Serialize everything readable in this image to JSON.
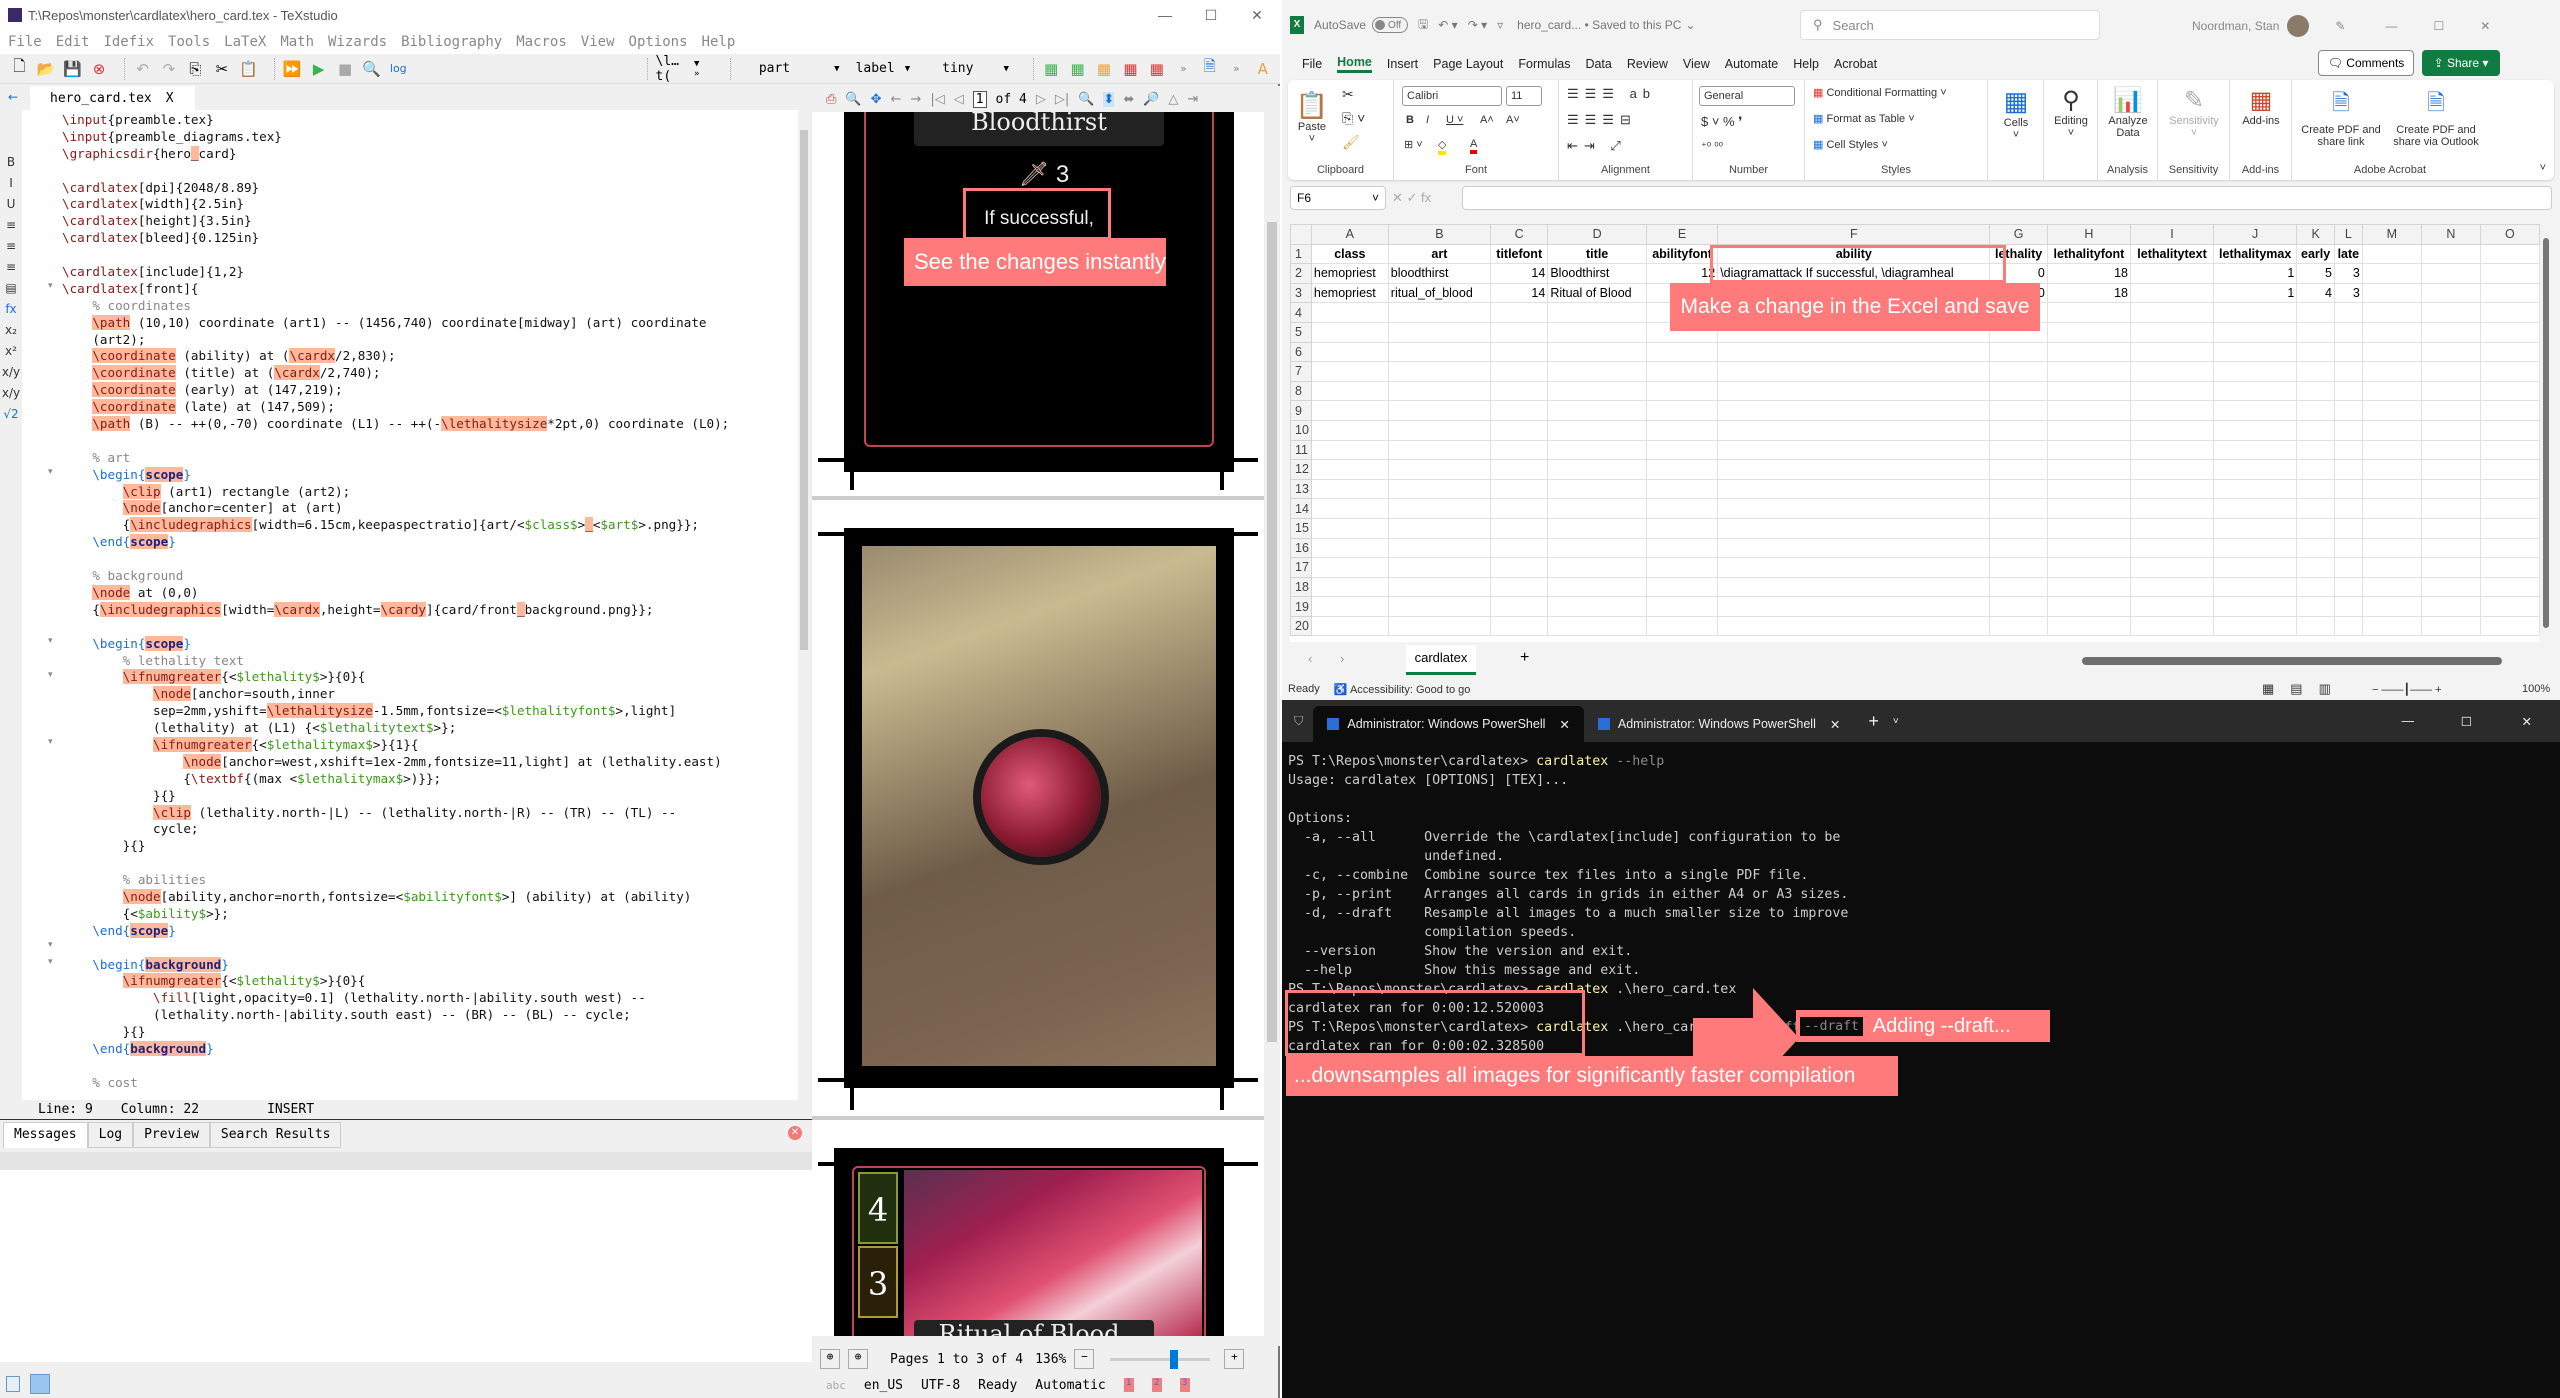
{
  "texstudio": {
    "window_title": "T:\\Repos\\monster\\cardlatex\\hero_card.tex - TeXstudio",
    "menu": [
      "File",
      "Edit",
      "Idefix",
      "Tools",
      "LaTeX",
      "Math",
      "Wizards",
      "Bibliography",
      "Macros",
      "View",
      "Options",
      "Help"
    ],
    "toolbar": {
      "icons": [
        "new-file-icon",
        "open-folder-icon",
        "save-icon",
        "close-file-icon",
        "undo-icon",
        "redo-icon",
        "copy-icon",
        "cut-icon",
        "paste-icon",
        "build-view-icon",
        "compile-icon",
        "stop-icon",
        "view-pdf-icon",
        "log-icon"
      ],
      "log_label": "log",
      "combo_ref": "\\l…t(",
      "combo_section": "part",
      "combo_label": "label",
      "combo_size": "tiny"
    },
    "tab": {
      "label": "hero_card.tex",
      "close": "X"
    },
    "sidebar_icons": [
      "B",
      "I",
      "U",
      "≡",
      "≡",
      "≡",
      "▤",
      "fx",
      "x₂",
      "x²",
      "x/y",
      "x/y",
      "√2"
    ],
    "code_lines": [
      [
        [
          "kw",
          "\\input"
        ],
        [
          "",
          "{preamble.tex}"
        ]
      ],
      [
        [
          "kw",
          "\\input"
        ],
        [
          "",
          "{preamble_diagrams.tex}"
        ]
      ],
      [
        [
          "kw",
          "\\graphicsdir"
        ],
        [
          "",
          "{hero"
        ],
        [
          "hl",
          "_"
        ],
        [
          "",
          "card}"
        ]
      ],
      [
        [
          "",
          ""
        ]
      ],
      [
        [
          "kw",
          "\\cardlatex"
        ],
        [
          "",
          "[dpi]{2048/8.89}"
        ]
      ],
      [
        [
          "kw",
          "\\cardlatex"
        ],
        [
          "",
          "[width]{2.5in}"
        ]
      ],
      [
        [
          "kw",
          "\\cardlatex"
        ],
        [
          "",
          "[height]{3.5in}"
        ]
      ],
      [
        [
          "kw",
          "\\cardlatex"
        ],
        [
          "",
          "[bleed]{0.125in}"
        ]
      ],
      [
        [
          "",
          ""
        ]
      ],
      [
        [
          "kw",
          "\\cardlatex"
        ],
        [
          "",
          "[include]{1,2}"
        ]
      ],
      [
        [
          "kw",
          "\\cardlatex"
        ],
        [
          "",
          "[front]{"
        ]
      ],
      [
        [
          "",
          "    "
        ],
        [
          "cm",
          "% coordinates"
        ]
      ],
      [
        [
          "",
          "    "
        ],
        [
          "hlk",
          "\\path"
        ],
        [
          "",
          " (10,10) coordinate (art1) -- (1456,740) coordinate[midway] (art) coordinate"
        ]
      ],
      [
        [
          "",
          "    (art2);"
        ]
      ],
      [
        [
          "",
          "    "
        ],
        [
          "hlk",
          "\\coordinate"
        ],
        [
          "",
          " (ability) at ("
        ],
        [
          "hlk",
          "\\cardx"
        ],
        [
          "",
          "/2,830);"
        ]
      ],
      [
        [
          "",
          "    "
        ],
        [
          "hlk",
          "\\coordinate"
        ],
        [
          "",
          " (title) at ("
        ],
        [
          "hlk",
          "\\cardx"
        ],
        [
          "",
          "/2,740);"
        ]
      ],
      [
        [
          "",
          "    "
        ],
        [
          "hlk",
          "\\coordinate"
        ],
        [
          "",
          " (early) at (147,219);"
        ]
      ],
      [
        [
          "",
          "    "
        ],
        [
          "hlk",
          "\\coordinate"
        ],
        [
          "",
          " (late) at (147,509);"
        ]
      ],
      [
        [
          "",
          "    "
        ],
        [
          "hlk",
          "\\path"
        ],
        [
          "",
          " (B) -- ++(0,-70) coordinate (L1) -- ++(-"
        ],
        [
          "hlk",
          "\\lethalitysize"
        ],
        [
          "",
          "*2pt,0) coordinate (L0);"
        ]
      ],
      [
        [
          "",
          ""
        ]
      ],
      [
        [
          "",
          "    "
        ],
        [
          "cm",
          "% art"
        ]
      ],
      [
        [
          "",
          "    "
        ],
        [
          "env",
          "\\begin{"
        ],
        [
          "envh",
          "scope"
        ],
        [
          "env",
          "}"
        ]
      ],
      [
        [
          "",
          "        "
        ],
        [
          "hlk",
          "\\clip"
        ],
        [
          "",
          " (art1) rectangle (art2);"
        ]
      ],
      [
        [
          "",
          "        "
        ],
        [
          "hlk",
          "\\node"
        ],
        [
          "",
          "[anchor=center] at (art)"
        ]
      ],
      [
        [
          "",
          "        {"
        ],
        [
          "hlk",
          "\\includegraphics"
        ],
        [
          "",
          "[width=6.15cm,keepaspectratio]{art/<"
        ],
        [
          "var",
          "$class$"
        ],
        [
          "",
          ">"
        ],
        [
          "hl",
          "_"
        ],
        [
          "",
          "<"
        ],
        [
          "var",
          "$art$"
        ],
        [
          "",
          ">.png}};"
        ]
      ],
      [
        [
          "",
          "    "
        ],
        [
          "env",
          "\\end{"
        ],
        [
          "envh",
          "scope"
        ],
        [
          "env",
          "}"
        ]
      ],
      [
        [
          "",
          ""
        ]
      ],
      [
        [
          "",
          "    "
        ],
        [
          "cm",
          "% background"
        ]
      ],
      [
        [
          "",
          "    "
        ],
        [
          "hlk",
          "\\node"
        ],
        [
          "",
          " at (0,0)"
        ]
      ],
      [
        [
          "",
          "    {"
        ],
        [
          "hlk",
          "\\includegraphics"
        ],
        [
          "",
          "[width="
        ],
        [
          "hlk",
          "\\cardx"
        ],
        [
          "",
          ",height="
        ],
        [
          "hlk",
          "\\cardy"
        ],
        [
          "",
          "]{card/front"
        ],
        [
          "hl",
          "_"
        ],
        [
          "",
          "background.png}};"
        ]
      ],
      [
        [
          "",
          ""
        ]
      ],
      [
        [
          "",
          "    "
        ],
        [
          "env",
          "\\begin{"
        ],
        [
          "envh",
          "scope"
        ],
        [
          "env",
          "}"
        ]
      ],
      [
        [
          "",
          "        "
        ],
        [
          "cm",
          "% lethality text"
        ]
      ],
      [
        [
          "",
          "        "
        ],
        [
          "hlk",
          "\\ifnumgreater"
        ],
        [
          "",
          "{<"
        ],
        [
          "var",
          "$lethality$"
        ],
        [
          "",
          ">}{0}{"
        ]
      ],
      [
        [
          "",
          "            "
        ],
        [
          "hlk",
          "\\node"
        ],
        [
          "",
          "[anchor=south,inner"
        ]
      ],
      [
        [
          "",
          "            sep=2mm,yshift="
        ],
        [
          "hlk",
          "\\lethalitysize"
        ],
        [
          "",
          "-1.5mm,fontsize=<"
        ],
        [
          "var",
          "$lethalityfont$"
        ],
        [
          "",
          ">,light]"
        ]
      ],
      [
        [
          "",
          "            (lethality) at (L1) {<"
        ],
        [
          "var",
          "$lethalitytext$"
        ],
        [
          "",
          ">};"
        ]
      ],
      [
        [
          "",
          "            "
        ],
        [
          "hlk",
          "\\ifnumgreater"
        ],
        [
          "",
          "{<"
        ],
        [
          "var",
          "$lethalitymax$"
        ],
        [
          "",
          ">}{1}{"
        ]
      ],
      [
        [
          "",
          "                "
        ],
        [
          "hlk",
          "\\node"
        ],
        [
          "",
          "[anchor=west,xshift=1ex-2mm,fontsize=11,light] at (lethality.east)"
        ]
      ],
      [
        [
          "",
          "                {"
        ],
        [
          "kw",
          "\\textbf"
        ],
        [
          "",
          "{(max <"
        ],
        [
          "var",
          "$lethalitymax$"
        ],
        [
          "",
          ">)}};"
        ]
      ],
      [
        [
          "",
          "            }{}"
        ]
      ],
      [
        [
          "",
          "            "
        ],
        [
          "hlk",
          "\\clip"
        ],
        [
          "",
          " (lethality.north-|L) -- (lethality.north-|R) -- (TR) -- (TL) --"
        ]
      ],
      [
        [
          "",
          "            cycle;"
        ]
      ],
      [
        [
          "",
          "        }{}"
        ]
      ],
      [
        [
          "",
          ""
        ]
      ],
      [
        [
          "",
          "        "
        ],
        [
          "cm",
          "% abilities"
        ]
      ],
      [
        [
          "",
          "        "
        ],
        [
          "hlk",
          "\\node"
        ],
        [
          "",
          "[ability,anchor=north,fontsize=<"
        ],
        [
          "var",
          "$abilityfont$"
        ],
        [
          "",
          ">] (ability) at (ability)"
        ]
      ],
      [
        [
          "",
          "        {<"
        ],
        [
          "var",
          "$ability$"
        ],
        [
          "",
          ">};"
        ]
      ],
      [
        [
          "",
          "    "
        ],
        [
          "env",
          "\\end{"
        ],
        [
          "envh",
          "scope"
        ],
        [
          "env",
          "}"
        ]
      ],
      [
        [
          "",
          ""
        ]
      ],
      [
        [
          "",
          "    "
        ],
        [
          "env",
          "\\begin{"
        ],
        [
          "envh",
          "background"
        ],
        [
          "env",
          "}"
        ]
      ],
      [
        [
          "",
          "        "
        ],
        [
          "hlk",
          "\\ifnumgreater"
        ],
        [
          "",
          "{<"
        ],
        [
          "var",
          "$lethality$"
        ],
        [
          "",
          ">}{0}{"
        ]
      ],
      [
        [
          "",
          "            "
        ],
        [
          "kw",
          "\\fill"
        ],
        [
          "",
          "[light,opacity=0.1] (lethality.north-|ability.south west) --"
        ]
      ],
      [
        [
          "",
          "            (lethality.north-|ability.south east) -- (BR) -- (BL) -- cycle;"
        ]
      ],
      [
        [
          "",
          "        }{}"
        ]
      ],
      [
        [
          "",
          "    "
        ],
        [
          "env",
          "\\end{"
        ],
        [
          "envh",
          "background"
        ],
        [
          "env",
          "}"
        ]
      ],
      [
        [
          "",
          ""
        ]
      ],
      [
        [
          "",
          "    "
        ],
        [
          "cm",
          "% cost"
        ]
      ]
    ],
    "status": {
      "line": "Line: 9",
      "column": "Column: 22",
      "mode": "INSERT"
    },
    "message_tabs": [
      "Messages",
      "Log",
      "Preview",
      "Search Results"
    ],
    "pdf": {
      "page_current": "1",
      "page_of": "of 4",
      "pages_range": "Pages 1 to 3 of 4",
      "zoom": "136%",
      "zoom_level_percent": 136,
      "card1": {
        "title": "Bloodthirst",
        "lethality": "3",
        "ability_text": "If successful,"
      },
      "card3": {
        "title": "Ritual of Blood",
        "early": "4",
        "late": "3"
      }
    },
    "app_status": {
      "language": "en_US",
      "encoding": "UTF-8",
      "state": "Ready",
      "mode": "Automatic",
      "bookmarks": [
        "1",
        "2",
        "3"
      ]
    }
  },
  "excel": {
    "autosave_label": "AutoSave",
    "autosave_state": "Off",
    "file_title": "hero_card... • Saved to this PC",
    "search_placeholder": "Search",
    "user": "Noordman, Stan",
    "tabs": [
      "File",
      "Home",
      "Insert",
      "Page Layout",
      "Formulas",
      "Data",
      "Review",
      "View",
      "Automate",
      "Help",
      "Acrobat"
    ],
    "active_tab": "Home",
    "comments_label": "Comments",
    "share_label": "Share",
    "ribbon": {
      "paste": "Paste",
      "font_name": "Calibri",
      "font_size": "11",
      "number_format": "General",
      "conditional_formatting": "Conditional Formatting",
      "format_as_table": "Format as Table",
      "cell_styles": "Cell Styles",
      "cells": "Cells",
      "editing": "Editing",
      "analyze_data": "Analyze Data",
      "sensitivity": "Sensitivity",
      "add_ins": "Add-ins",
      "create_pdf_link": "Create PDF and share link",
      "create_pdf_outlook": "Create PDF and share via Outlook",
      "groups": [
        "Clipboard",
        "Font",
        "Alignment",
        "Number",
        "Styles",
        "Analysis",
        "Sensitivity",
        "Add-ins",
        "Adobe Acrobat"
      ]
    },
    "name_box": "F6",
    "fx_symbols": "✕ ✓ fx",
    "columns": [
      "A",
      "B",
      "C",
      "D",
      "E",
      "F",
      "G",
      "H",
      "I",
      "J",
      "K",
      "L",
      "M",
      "N",
      "O"
    ],
    "rows": [
      [
        "class",
        "art",
        "titlefont",
        "title",
        "abilityfont",
        "ability",
        "lethality",
        "lethalityfont",
        "lethalitytext",
        "lethalitymax",
        "early",
        "late",
        "",
        "",
        ""
      ],
      [
        "hemopriest",
        "bloodthirst",
        "14",
        "Bloodthirst",
        "12",
        "\\diagramattack If successful, \\diagramheal",
        "0",
        "18",
        "",
        "1",
        "5",
        "3",
        "",
        "",
        ""
      ],
      [
        "hemopriest",
        "ritual_of_blood",
        "14",
        "Ritual of Blood",
        "",
        "",
        "0",
        "18",
        "",
        "1",
        "4",
        "3",
        "",
        "",
        ""
      ]
    ],
    "total_rows": 20,
    "sheet_tab": "cardlatex",
    "status_ready": "Ready",
    "accessibility": "Accessibility: Good to go",
    "zoom": "100%"
  },
  "terminal": {
    "tabs": [
      "Administrator: Windows PowerShell",
      "Administrator: Windows PowerShell"
    ],
    "lines": [
      [
        [
          "",
          "PS T:\\Repos\\monster\\cardlatex> "
        ],
        [
          "cmd",
          "cardlatex"
        ],
        [
          "dim",
          " --help"
        ]
      ],
      [
        [
          "",
          "Usage: cardlatex [OPTIONS] [TEX]..."
        ]
      ],
      [
        [
          "",
          ""
        ]
      ],
      [
        [
          "",
          "Options:"
        ]
      ],
      [
        [
          "",
          "  -a, --all      Override the \\cardlatex[include] configuration to be"
        ]
      ],
      [
        [
          "",
          "                 undefined."
        ]
      ],
      [
        [
          "",
          "  -c, --combine  Combine source tex files into a single PDF file."
        ]
      ],
      [
        [
          "",
          "  -p, --print    Arranges all cards in grids in either A4 or A3 sizes."
        ]
      ],
      [
        [
          "",
          "  -d, --draft    Resample all images to a much smaller size to improve"
        ]
      ],
      [
        [
          "",
          "                 compilation speeds."
        ]
      ],
      [
        [
          "",
          "  --version      Show the version and exit."
        ]
      ],
      [
        [
          "",
          "  --help         Show this message and exit."
        ]
      ],
      [
        [
          "",
          "PS T:\\Repos\\monster\\cardlatex> "
        ],
        [
          "cmd",
          "cardlatex"
        ],
        [
          "",
          " .\\hero_card.tex"
        ]
      ],
      [
        [
          "",
          "cardlatex ran for 0:00:12.520003"
        ]
      ],
      [
        [
          "",
          "PS T:\\Repos\\monster\\cardlatex> "
        ],
        [
          "cmd",
          "cardlatex"
        ],
        [
          "",
          " .\\hero_card.tex "
        ],
        [
          "dim",
          "--draft"
        ]
      ],
      [
        [
          "",
          "cardlatex ran for 0:00:02.328500"
        ]
      ]
    ],
    "draft_flag": "--draft"
  },
  "callouts": {
    "pdf": "See the changes instantly",
    "excel": "Make a change in the Excel and save",
    "draft": "Adding --draft...",
    "downsample": "...downsamples all images for significantly faster compilation"
  },
  "colors": {
    "callout": "#ff7b7b",
    "excel_green": "#107c41",
    "tex_keyword_highlight": "#ffb899"
  }
}
